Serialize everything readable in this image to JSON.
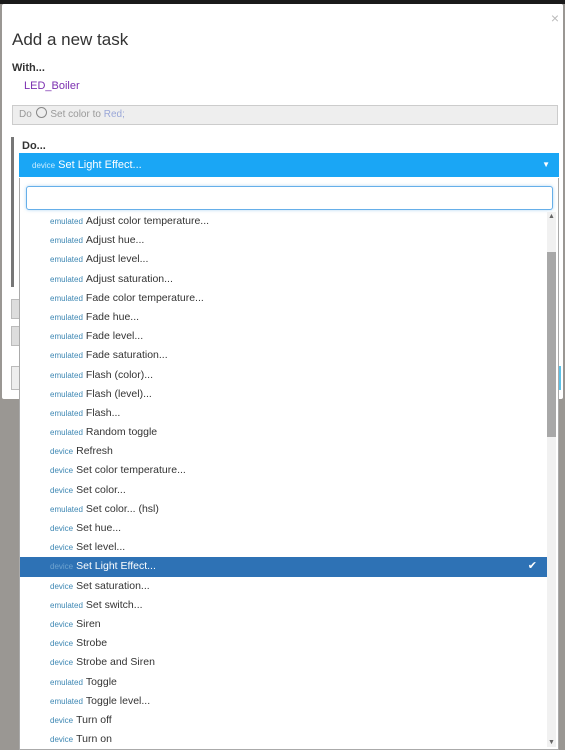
{
  "modal": {
    "title": "Add a new task",
    "close_glyph": "×",
    "with_label": "With...",
    "device_name": "LED_Boiler",
    "condition": {
      "prefix": "Do",
      "text": "Set color to ",
      "value": "Red;"
    },
    "do_label": "Do..."
  },
  "select": {
    "current_kind": "device",
    "current_label": "Set Light Effect...",
    "caret": "▼",
    "search_placeholder": ""
  },
  "options": [
    {
      "kind": "emulated",
      "label": "Adjust color temperature..."
    },
    {
      "kind": "emulated",
      "label": "Adjust hue..."
    },
    {
      "kind": "emulated",
      "label": "Adjust level..."
    },
    {
      "kind": "emulated",
      "label": "Adjust saturation..."
    },
    {
      "kind": "emulated",
      "label": "Fade color temperature..."
    },
    {
      "kind": "emulated",
      "label": "Fade hue..."
    },
    {
      "kind": "emulated",
      "label": "Fade level..."
    },
    {
      "kind": "emulated",
      "label": "Fade saturation..."
    },
    {
      "kind": "emulated",
      "label": "Flash (color)..."
    },
    {
      "kind": "emulated",
      "label": "Flash (level)..."
    },
    {
      "kind": "emulated",
      "label": "Flash..."
    },
    {
      "kind": "emulated",
      "label": "Random toggle"
    },
    {
      "kind": "device",
      "label": "Refresh"
    },
    {
      "kind": "device",
      "label": "Set color temperature..."
    },
    {
      "kind": "device",
      "label": "Set color..."
    },
    {
      "kind": "emulated",
      "label": "Set color... (hsl)"
    },
    {
      "kind": "device",
      "label": "Set hue..."
    },
    {
      "kind": "device",
      "label": "Set level..."
    },
    {
      "kind": "device",
      "label": "Set Light Effect...",
      "selected": true
    },
    {
      "kind": "device",
      "label": "Set saturation..."
    },
    {
      "kind": "emulated",
      "label": "Set switch..."
    },
    {
      "kind": "device",
      "label": "Siren"
    },
    {
      "kind": "device",
      "label": "Strobe"
    },
    {
      "kind": "device",
      "label": "Strobe and Siren"
    },
    {
      "kind": "emulated",
      "label": "Toggle"
    },
    {
      "kind": "emulated",
      "label": "Toggle level..."
    },
    {
      "kind": "device",
      "label": "Turn off"
    },
    {
      "kind": "device",
      "label": "Turn on"
    }
  ],
  "colors": {
    "accent": "#1aa6f5",
    "selected_row": "#2e72b5",
    "device_name": "#7b2fb0"
  }
}
